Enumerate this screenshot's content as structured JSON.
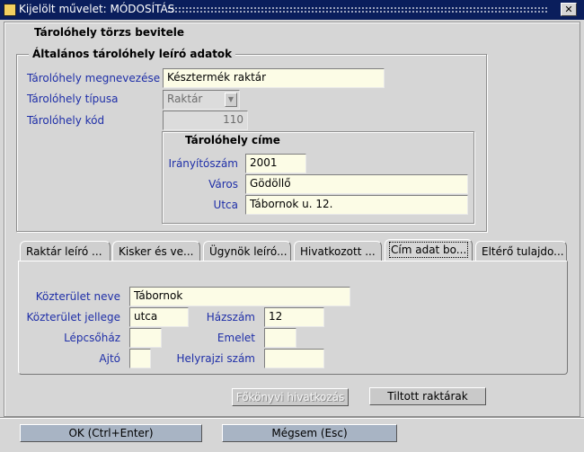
{
  "window": {
    "title": "Kijelölt művelet: MÓDOSÍTÁS",
    "close_glyph": "✕"
  },
  "form": {
    "header": "Tárolóhely törzs bevitele",
    "general_group": {
      "header": "Általános tárolóhely leíró adatok",
      "name_label": "Tárolóhely megnevezése",
      "name_value": "Késztermék raktár",
      "type_label": "Tárolóhely típusa",
      "type_value": "Raktár",
      "code_label": "Tárolóhely kód",
      "code_value": "110"
    },
    "address_group": {
      "header": "Tárolóhely címe",
      "zip_label": "Irányítószám",
      "zip_value": "2001",
      "city_label": "Város",
      "city_value": "Gödöllő",
      "street_label": "Utca",
      "street_value": "Tábornok u. 12."
    }
  },
  "tabs": [
    {
      "label": "Raktár leíró ..."
    },
    {
      "label": "Kisker és ve..."
    },
    {
      "label": "Ügynök leíró..."
    },
    {
      "label": "Hivatkozott ..."
    },
    {
      "label": "Cím adat bo...",
      "active": true
    },
    {
      "label": "Eltérő tulajdo..."
    }
  ],
  "address_tab": {
    "public_space_name_label": "Közterület neve",
    "public_space_name_value": "Tábornok",
    "public_space_type_label": "Közterület jellege",
    "public_space_type_value": "utca",
    "house_number_label": "Házszám",
    "house_number_value": "12",
    "staircase_label": "Lépcsőház",
    "staircase_value": "",
    "floor_label": "Emelet",
    "floor_value": "",
    "door_label": "Ajtó",
    "door_value": "",
    "lot_number_label": "Helyrajzi szám",
    "lot_number_value": ""
  },
  "buttons": {
    "ledger_reference": "Főkönyvi hivatkozás",
    "ledger_reference_enabled": false,
    "forbidden_warehouses": "Tiltott raktárak",
    "ok": "OK (Ctrl+Enter)",
    "cancel": "Mégsem (Esc)"
  }
}
